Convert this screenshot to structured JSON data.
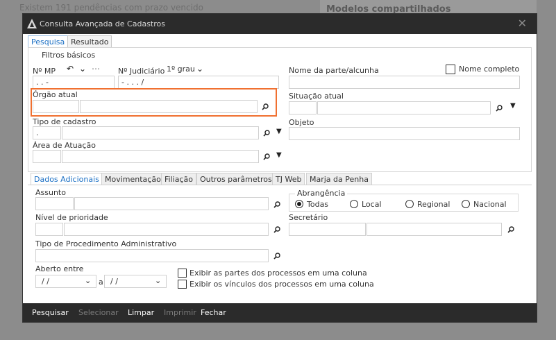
{
  "background": {
    "line1": "Existem 191 pendências com prazo vencido",
    "panel_title": "Modelos compartilhados"
  },
  "dialog": {
    "title": "Consulta Avançada de Cadastros",
    "tabs": [
      {
        "label": "Pesquisa"
      },
      {
        "label": "Resultado"
      }
    ],
    "filters": {
      "legend": "Filtros básicos",
      "nmp_label": "Nº MP",
      "nmp_value": ".    .    -",
      "njud_label": "Nº Judiciário",
      "grau_value": "1º grau",
      "njud_value": "-    .    .    .    /",
      "nome_label": "Nome da parte/alcunha",
      "nome_completo_label": "Nome completo",
      "orgao_label": "Órgão atual",
      "situacao_label": "Situação atual",
      "tipo_label": "Tipo de cadastro",
      "tipo_value": ".",
      "objeto_label": "Objeto",
      "area_label": "Área de Atuação"
    },
    "subtabs": [
      {
        "label": "Dados Adicionais"
      },
      {
        "label": "Movimentação"
      },
      {
        "label": "Filiação"
      },
      {
        "label": "Outros parâmetros"
      },
      {
        "label": "TJ Web"
      },
      {
        "label": "Marja da Penha"
      }
    ],
    "additional": {
      "assunto_label": "Assunto",
      "abrangencia_label": "Abrangência",
      "radios": [
        {
          "label": "Todas",
          "selected": true
        },
        {
          "label": "Local",
          "selected": false
        },
        {
          "label": "Regional",
          "selected": false
        },
        {
          "label": "Nacional",
          "selected": false
        }
      ],
      "nivel_label": "Nível de prioridade",
      "secretario_label": "Secretário",
      "tipo_proc_label": "Tipo de Procedimento Administrativo",
      "aberto_label": "Aberto entre",
      "date_from": "/ /",
      "date_sep": "a",
      "date_to": "/ /",
      "chk_partes": "Exibir as partes dos processos em uma coluna",
      "chk_vinculos": "Exibir os vínculos dos processos em uma coluna"
    },
    "buttons": {
      "pesquisar": "Pesquisar",
      "selecionar": "Selecionar",
      "limpar": "Limpar",
      "imprimir": "Imprimir",
      "fechar": "Fechar"
    }
  }
}
